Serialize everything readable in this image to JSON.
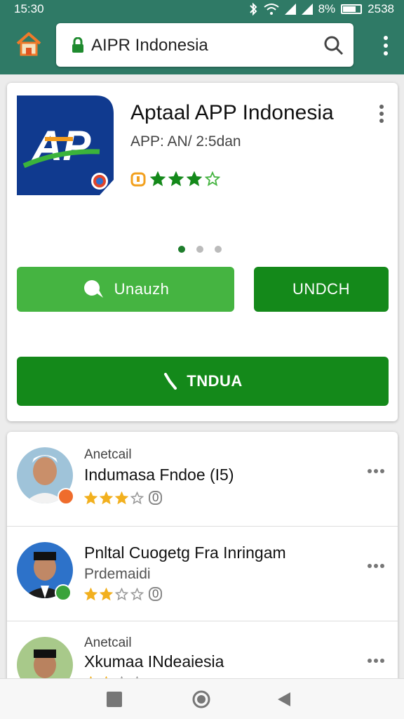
{
  "status_bar": {
    "time": "15:30",
    "battery": "8%",
    "right_text": "2538",
    "icons": [
      "bluetooth-icon",
      "wifi-icon",
      "signal-icon",
      "signal-icon",
      "battery-icon"
    ]
  },
  "browser": {
    "url": "AIPR Indonesia",
    "icons": [
      "home-icon",
      "lock-icon",
      "search-icon",
      "more-vert-icon"
    ]
  },
  "app": {
    "title": "Aptaal APP Indonesia",
    "subtitle": "APP: AN/ 2:5dan",
    "rating": 3,
    "max_rating": 4,
    "logo_text": "AP",
    "pager": {
      "count": 3,
      "active": 0
    },
    "buttons": {
      "unauth": "Unauzh",
      "undch": "UNDCH",
      "tndua": "TNDUA"
    }
  },
  "list": [
    {
      "kicker": "Anetcail",
      "title": "Indumasa Fndoe (I5)",
      "subtitle": "",
      "rating": 3,
      "count": "0",
      "badge_color": "#ef6c2c"
    },
    {
      "kicker": "",
      "title": "Pnltal Cuogetg Fra Inringam",
      "subtitle": "Prdemaidi",
      "rating": 2,
      "count": "0",
      "badge_color": "#3aa33b"
    },
    {
      "kicker": "Anetcail",
      "title": "Xkumaa INdeaiesia",
      "subtitle": "",
      "rating": 2,
      "count": "",
      "badge_color": ""
    }
  ],
  "colors": {
    "header": "#2f7a66",
    "primary_green": "#14891a",
    "light_green": "#45b441",
    "star": "#f2b01e",
    "logo_blue": "#103a8f"
  },
  "nav": [
    "recents-square-icon",
    "home-circle-icon",
    "back-triangle-icon"
  ]
}
